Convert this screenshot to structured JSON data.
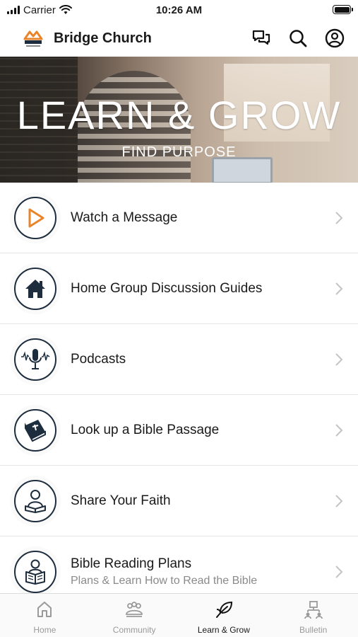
{
  "status_bar": {
    "carrier": "Carrier",
    "time": "10:26 AM"
  },
  "header": {
    "title": "Bridge Church",
    "icons": [
      "chat-icon",
      "search-icon",
      "profile-icon"
    ]
  },
  "hero": {
    "title": "LEARN & GROW",
    "subtitle": "FIND PURPOSE"
  },
  "menu": {
    "items": [
      {
        "label": "Watch a Message",
        "subtitle": "",
        "icon": "play-icon",
        "icon_color": "#e8852a"
      },
      {
        "label": "Home Group Discussion Guides",
        "subtitle": "",
        "icon": "house-icon",
        "icon_color": "#1e2d3d"
      },
      {
        "label": "Podcasts",
        "subtitle": "",
        "icon": "microphone-icon",
        "icon_color": "#1e2d3d"
      },
      {
        "label": "Look up a Bible Passage",
        "subtitle": "",
        "icon": "bible-icon",
        "icon_color": "#1e2d3d"
      },
      {
        "label": "Share Your Faith",
        "subtitle": "",
        "icon": "reader-icon",
        "icon_color": "#1e2d3d"
      },
      {
        "label": "Bible Reading Plans",
        "subtitle": "Plans & Learn How to Read the Bible",
        "icon": "person-reading-icon",
        "icon_color": "#1e2d3d"
      }
    ]
  },
  "tab_bar": {
    "tabs": [
      {
        "label": "Home",
        "icon": "home-tab-icon",
        "active": false
      },
      {
        "label": "Community",
        "icon": "community-icon",
        "active": false
      },
      {
        "label": "Learn & Grow",
        "icon": "leaf-icon",
        "active": true
      },
      {
        "label": "Bulletin",
        "icon": "bulletin-icon",
        "active": false
      }
    ]
  },
  "colors": {
    "accent": "#e8852a",
    "icon_navy": "#1e2d3d",
    "inactive_tab": "#9a9a9a"
  }
}
